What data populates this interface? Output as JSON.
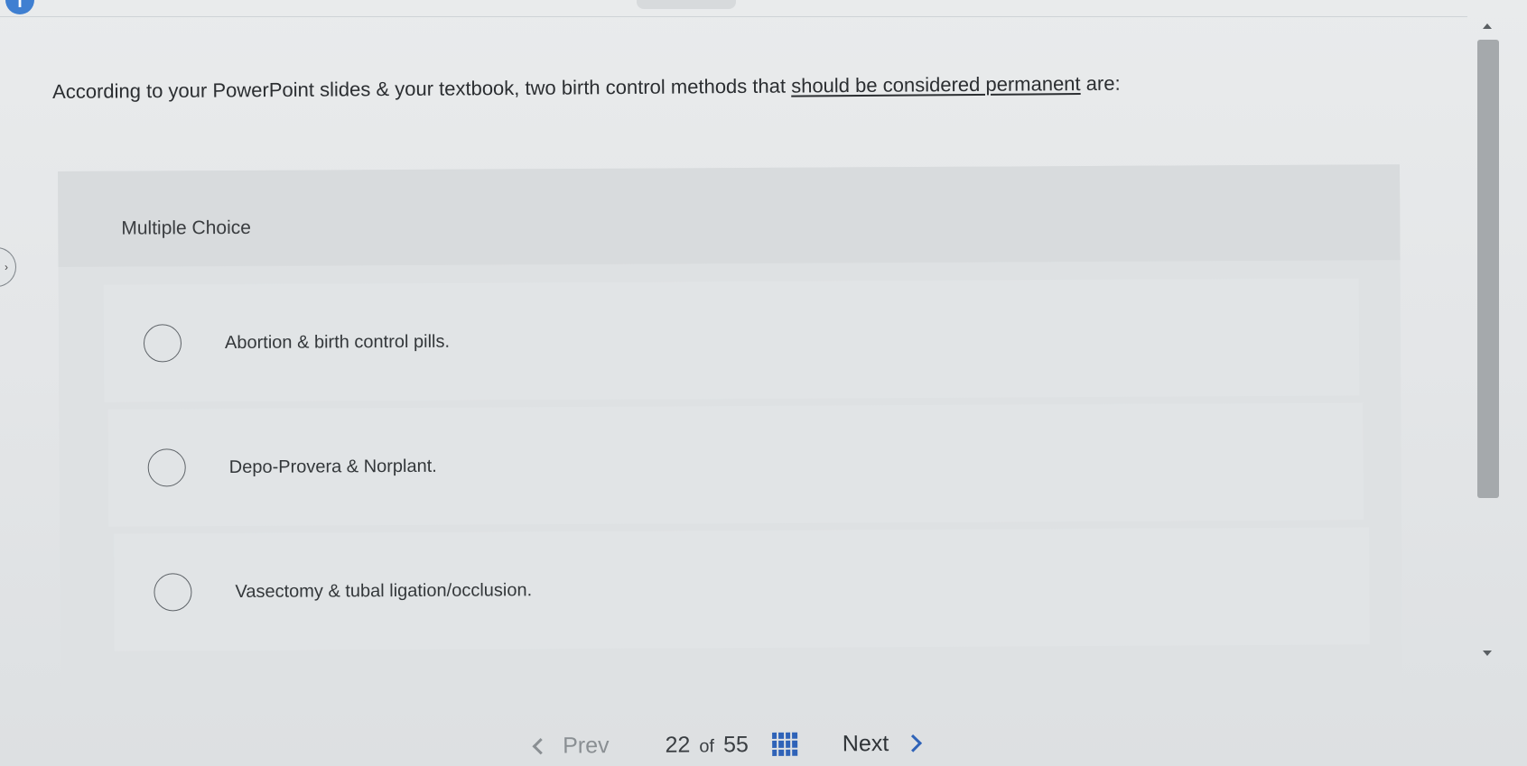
{
  "question": {
    "prefix": "According to your PowerPoint slides & your textbook, two birth control methods that ",
    "emphasis": "should be considered permanent",
    "suffix": " are:"
  },
  "question_type": "Multiple Choice",
  "options": [
    {
      "label": "Abortion & birth control pills."
    },
    {
      "label": "Depo-Provera & Norplant."
    },
    {
      "label": "Vasectomy & tubal ligation/occlusion."
    }
  ],
  "navigation": {
    "prev_label": "Prev",
    "current_page": "22",
    "of_label": "of",
    "total_pages": "55",
    "next_label": "Next"
  },
  "icons": {
    "info": "info-icon",
    "grid": "grid-icon",
    "prev": "chevron-left-icon",
    "next": "chevron-right-icon"
  },
  "colors": {
    "accent": "#2f63b8",
    "info_badge": "#3f7fd1"
  }
}
